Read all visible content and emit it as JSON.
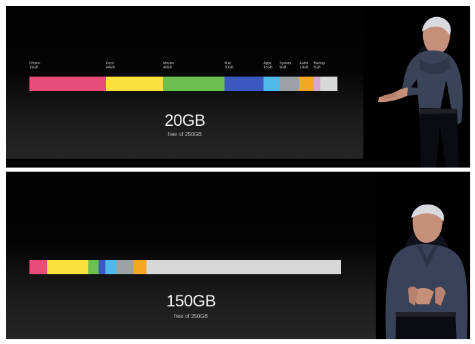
{
  "top_slide": {
    "segments": [
      {
        "label": "Photos",
        "size": "19GB",
        "color": "#e74c7b",
        "share": 0.246
      },
      {
        "label": "Docs",
        "size": "44GB",
        "color": "#fbe13b",
        "share": 0.183
      },
      {
        "label": "Movies",
        "size": "40GB",
        "color": "#6cc04e",
        "share": 0.198
      },
      {
        "label": "Mail",
        "size": "30GB",
        "color": "#3c59c2",
        "share": 0.125
      },
      {
        "label": "Apps",
        "size": "15GB",
        "color": "#50b9ec",
        "share": 0.051
      },
      {
        "label": "System",
        "size": "9GB",
        "color": "#9ca1a4",
        "share": 0.064
      },
      {
        "label": "Audio",
        "size": "13GB",
        "color": "#f5a623",
        "share": 0.046
      },
      {
        "label": "Backup",
        "size": "6GB",
        "color": "#d4a7d1",
        "share": 0.022
      },
      {
        "label": "",
        "size": "",
        "color": "#d8d8d8",
        "share": 0.055
      }
    ],
    "free_amount": "20GB",
    "free_caption": "free of 250GB"
  },
  "bottom_slide": {
    "segments": [
      {
        "color": "#e74c7b",
        "share": 0.058
      },
      {
        "color": "#fbe13b",
        "share": 0.132
      },
      {
        "color": "#6cc04e",
        "share": 0.033
      },
      {
        "color": "#3c59c2",
        "share": 0.022
      },
      {
        "color": "#50b9ec",
        "share": 0.035
      },
      {
        "color": "#9ca1a4",
        "share": 0.055
      },
      {
        "color": "#f5a623",
        "share": 0.04
      },
      {
        "color": "#d8d8d8",
        "share": 0.625
      }
    ],
    "free_amount": "150GB",
    "free_caption": "free of 250GB"
  },
  "colors": {
    "frame": "#000000",
    "page": "#ffffff",
    "text": "#f1f1f1"
  },
  "presenters": {
    "top": "presenter-photo",
    "bottom": "presenter-photo"
  }
}
